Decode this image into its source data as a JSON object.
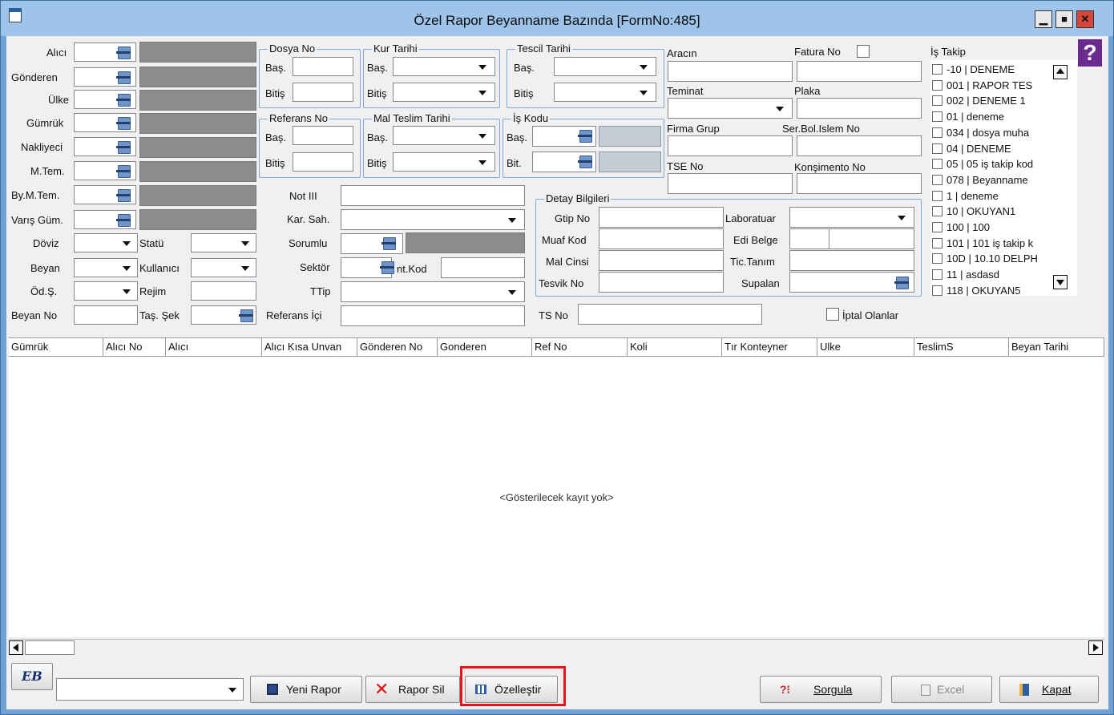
{
  "window": {
    "title": "Özel Rapor Beyanname Bazında [FormNo:485]",
    "min": "▁",
    "max": "■",
    "close": "✕",
    "help": "?"
  },
  "left_labels": {
    "alici": "Alıcı",
    "gonderen": "Gönderen",
    "ulke": "Ülke",
    "gumruk": "Gümrük",
    "nakliyeci": "Nakliyeci",
    "mtem": "M.Tem.",
    "bymtem": "By.M.Tem.",
    "varis": "Varış Güm.",
    "doviz": "Döviz",
    "statu": "Statü",
    "beyan": "Beyan",
    "kullanici": "Kullanıcı",
    "ods": "Öd.Ş.",
    "rejim": "Rejim",
    "beyanno": "Beyan No",
    "tassek": "Taş. Şek"
  },
  "groups": {
    "dosya": "Dosya No",
    "kur": "Kur Tarihi",
    "tescil": "Tescil Tarihi",
    "referans": "Referans No",
    "malteslim": "Mal Teslim Tarihi",
    "iskodu": "İş Kodu",
    "detay": "Detay Bilgileri"
  },
  "range": {
    "bas": "Baş.",
    "bitis": "Bitiş",
    "bit": "Bit."
  },
  "mid_labels": {
    "notiii": "Not III",
    "karsah": "Kar. Sah.",
    "sorumlu": "Sorumlu",
    "sektor": "Sektör",
    "ntkod": "nt.Kod",
    "ttip": "TTip",
    "refici": "Referans İçi"
  },
  "right_labels": {
    "aracin": "Aracın",
    "faturano": "Fatura No",
    "teminat": "Teminat",
    "plaka": "Plaka",
    "firmagrup": "Firma Grup",
    "serbol": "Ser.Bol.Islem No",
    "tseno": "TSE No",
    "konsimento": "Konşimento No"
  },
  "detay_labels": {
    "gtip": "Gtip No",
    "laboratuar": "Laboratuar",
    "muaf": "Muaf Kod",
    "edibelge": "Edi Belge",
    "malcinsi": "Mal Cinsi",
    "tictanim": "Tic.Tanım",
    "tesvik": "Tesvik No",
    "supalan": "Supalan"
  },
  "tsno": "TS No",
  "iptal": "İptal Olanlar",
  "istakip": {
    "label": "İş Takip",
    "items": [
      "-10 | DENEME",
      "001 | RAPOR TES",
      "002 | DENEME 1",
      "01 | deneme",
      "034 | dosya muha",
      "04 | DENEME",
      "05 | 05 iş takip kod",
      "078 | Beyanname",
      "1 | deneme",
      "10 | OKUYAN1",
      "100 | 100",
      "101 | 101 iş takip k",
      "10D | 10.10 DELPH",
      "11 | asdasd",
      "118 | OKUYAN5"
    ]
  },
  "columns": [
    "Gümrük",
    "Alıcı No",
    "Alıcı",
    "Alıcı Kısa Unvan",
    "Gönderen No",
    "Gonderen",
    "Ref No",
    "Koli",
    "Tır Konteyner",
    "Ulke",
    "TeslimS",
    "Beyan Tarihi"
  ],
  "empty_text": "<Gösterilecek kayıt yok>",
  "buttons": {
    "eb": "EB",
    "yeni": "Yeni Rapor",
    "sil": "Rapor Sil",
    "ozel": "Özelleştir",
    "sorgula": "Sorgula",
    "excel": "Excel",
    "kapat": "Kapat"
  },
  "colors": {
    "highlight": "#e8121a",
    "accent": "#2b5fa6"
  }
}
